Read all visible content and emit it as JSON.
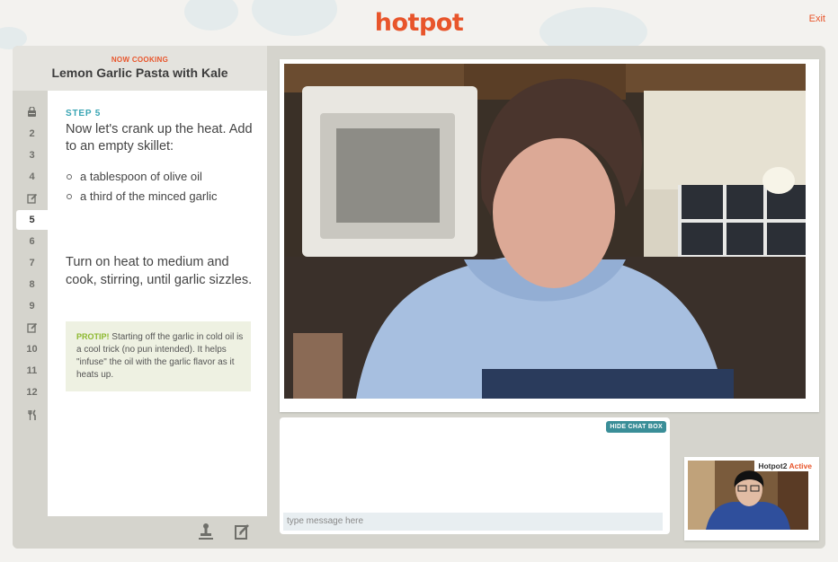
{
  "header": {
    "logo": "hotpot",
    "exit_label": "Exit"
  },
  "recipe": {
    "now_cooking_label": "NOW COOKING",
    "title": "Lemon Garlic Pasta with Kale"
  },
  "steps_nav": [
    {
      "label": "",
      "icon": "shopping-bag-icon"
    },
    {
      "label": "2"
    },
    {
      "label": "3"
    },
    {
      "label": "4"
    },
    {
      "label": "",
      "icon": "note-edit-icon"
    },
    {
      "label": "5",
      "active": true
    },
    {
      "label": "6"
    },
    {
      "label": "7"
    },
    {
      "label": "8"
    },
    {
      "label": "9"
    },
    {
      "label": "",
      "icon": "note-edit-icon"
    },
    {
      "label": "10"
    },
    {
      "label": "11"
    },
    {
      "label": "12"
    },
    {
      "label": "",
      "icon": "fork-knife-icon"
    }
  ],
  "step": {
    "label": "STEP 5",
    "intro": "Now let's crank up the heat. Add to an empty skillet:",
    "ingredients": [
      "a tablespoon of olive oil",
      "a third of the minced garlic"
    ],
    "outro": "Turn on heat to medium and cook, stirring, until garlic sizzles.",
    "protip_label": "PROTIP!",
    "protip_text": "Starting off the garlic in cold oil is a cool trick (no pun intended). It helps \"infuse\" the oil with the garlic flavor as it heats up."
  },
  "bottom_icons": [
    "stamp-icon",
    "edit-note-icon"
  ],
  "chat": {
    "hide_label": "HIDE CHAT BOX",
    "input_placeholder": "type message here",
    "input_value": ""
  },
  "participant": {
    "name": "Hotpot2",
    "status": "Active"
  },
  "colors": {
    "brand": "#e8552b",
    "accent": "#3aa5b4",
    "protip": "#8cb82e",
    "panel": "#d5d4cd"
  }
}
